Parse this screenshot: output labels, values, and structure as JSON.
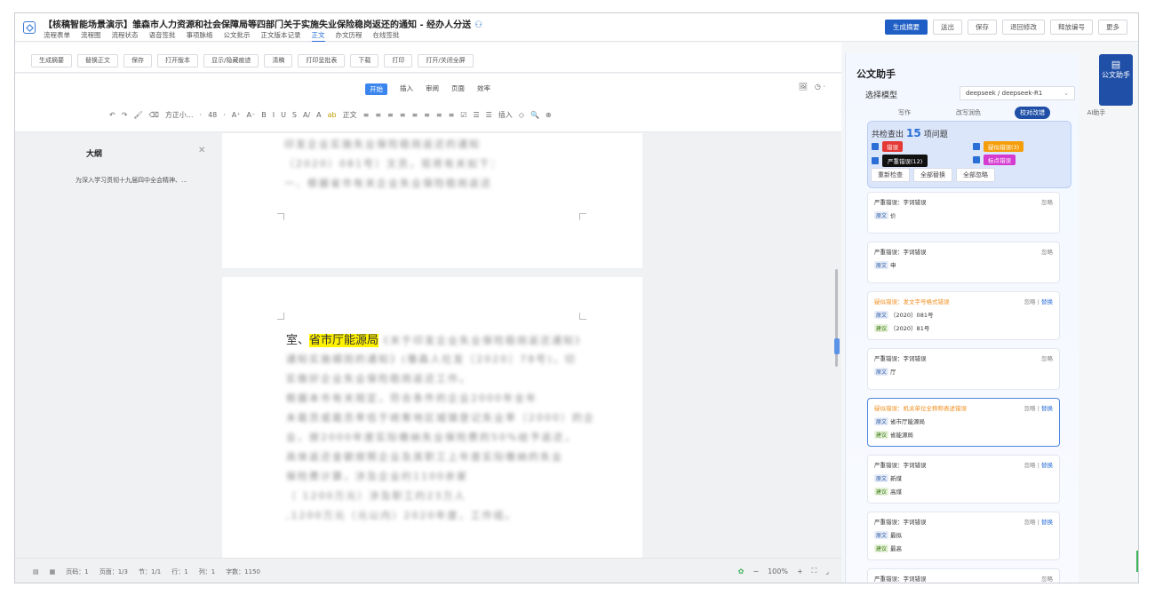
{
  "header": {
    "title": "【核稿智能场景演示】雏森市人力资源和社会保障局等四部门关于实施失业保险稳岗返还的通知 - 经办人分送",
    "tabs": [
      "流程表单",
      "流程图",
      "流程状态",
      "语音签批",
      "事项脉络",
      "公文批示",
      "正文版本记录",
      "正文",
      "办文历程",
      "在线签批"
    ],
    "active_tab": "正文",
    "buttons": [
      "生成摘要",
      "送出",
      "保存",
      "退回修改",
      "释放编号",
      "更多"
    ]
  },
  "toolbar": {
    "buttons": [
      "生成摘要",
      "替换正文",
      "保存",
      "打开版本",
      "显示/隐藏痕迹",
      "清稿",
      "打印呈批表",
      "下载",
      "打印",
      "打开/关闭全屏"
    ]
  },
  "ribbon": {
    "tabs": [
      "开始",
      "插入",
      "审阅",
      "页面",
      "效率"
    ],
    "active": "开始",
    "format": [
      "↶",
      "↷",
      "🖌",
      "⌫",
      "方正小...",
      "·",
      "48",
      "·",
      "A⁺",
      "A⁻",
      "B",
      "I",
      "U",
      "S",
      "A/",
      "A",
      "ab",
      "正文",
      "≡",
      "≡",
      "≡",
      "≡",
      "≡",
      "≡",
      "≡",
      "≡",
      "☑",
      "☰",
      "☰",
      "插入",
      "◇",
      "🔍",
      "⊕"
    ]
  },
  "outline": {
    "title": "大纲",
    "item": "为深入学习贯彻十九届四中全会精神、..."
  },
  "document": {
    "page1_lines": [
      "印发企业实施失业保险稳岗返还的通知",
      "（2020）081号）文员，现将有关如下：",
      "一、根据省市有关企业失业保险稳岗返还"
    ],
    "page2_first_prefix": "室、",
    "page2_highlight": "省市厅能源局",
    "page2_first_suffix": "《关于印发企业失业保险稳岗返还通知》",
    "page2_lines": [
      "通知实施细则的通知》(雏森人社发〔2020〕78号)，切",
      "实做好企业失业保险稳岗返还工作。",
      "根据本市有关规定，符合条件的企业2000年全年",
      "未裁员或裁员率低于统筹地区城镇登记失业率（2000）的企",
      "业，按2000年度实际缴纳失业保险费的50%给予返还，",
      "具体返还金额按照企业及其职工上年度实际缴纳的失业",
      "保险费计算，涉及企业约1100余家",
      "（ 1200万元）涉及职工约23万人",
      ",1200万元（元以内）2020年度，工作组。"
    ]
  },
  "status": {
    "page": "页码：1",
    "pages": "页面：1/3",
    "section": "节：1/1",
    "line": "行：1",
    "col": "列：1",
    "words": "字数：1150",
    "zoom": "100%"
  },
  "assistant": {
    "title": "公文助手",
    "model_label": "选择模型",
    "model_value": "deepseek / deepseek-R1",
    "modes": [
      "写作",
      "改写润色",
      "校对改错",
      "AI助手"
    ],
    "active_mode": "校对改错",
    "summary_prefix": "共检查出",
    "summary_count": "15",
    "summary_suffix": "项问题",
    "tags": [
      {
        "label": "错误",
        "color": "#e53935"
      },
      {
        "label": "疑似错误(3)",
        "color": "#f59e0b"
      },
      {
        "label": "严重错误(12)",
        "color": "#111111"
      },
      {
        "label": "标点错误",
        "color": "#d63bd1"
      }
    ],
    "actions": [
      "重新检查",
      "全部替换",
      "全部忽略"
    ],
    "ignore": "忽略",
    "replace": "替换",
    "orig_label": "原文",
    "sugg_label": "建议",
    "cards": [
      {
        "type": "严重错误：字词错误",
        "warn": false,
        "orig": "价",
        "sugg": "",
        "replace": false
      },
      {
        "type": "严重错误：字词错误",
        "warn": false,
        "orig": "申",
        "sugg": "",
        "replace": false
      },
      {
        "type": "疑似错误：发文字号格式错误",
        "warn": true,
        "orig": "〔2020〕081号",
        "sugg": "〔2020〕81号",
        "replace": true
      },
      {
        "type": "严重错误：字词错误",
        "warn": false,
        "orig": "厅",
        "sugg": "",
        "replace": false
      },
      {
        "type": "疑似错误：机关单位全称称表述错误",
        "warn": true,
        "orig": "省市厅能源局",
        "sugg": "省能源局",
        "replace": true,
        "selected": true
      },
      {
        "type": "严重错误：字词错误",
        "warn": false,
        "orig": "新煤",
        "sugg": "高煤",
        "replace": true
      },
      {
        "type": "严重错误：字词错误",
        "warn": false,
        "orig": "最拟",
        "sugg": "最高",
        "replace": true
      },
      {
        "type": "严重错误：字词错误",
        "warn": false,
        "orig": "",
        "sugg": "",
        "replace": false
      }
    ],
    "side_button": "公文助手"
  }
}
